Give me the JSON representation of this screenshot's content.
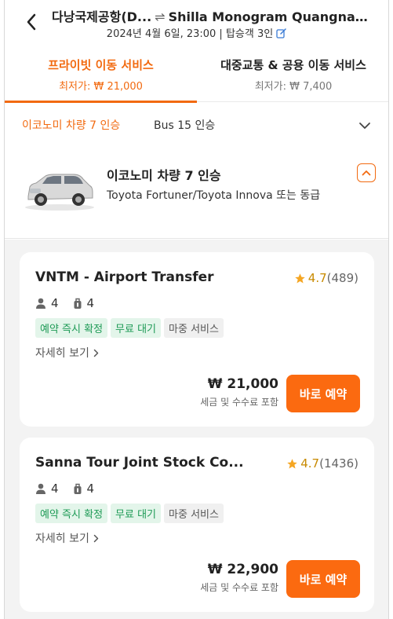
{
  "header": {
    "origin": "다낭국제공항(D...",
    "swap_symbol": "⇌",
    "destination": "Shilla Monogram Quangnam ...",
    "subtitle": "2024년 4월 6일, 23:00 | 탑승객 3인"
  },
  "tabs": [
    {
      "label": "프라이빗 이동 서비스",
      "price": "최저가: ₩ 21,000"
    },
    {
      "label": "대중교통 & 공용 이동 서비스",
      "price": "최저가: ₩ 7,400"
    }
  ],
  "segment": {
    "selected": "이코노미 차량 7 인승",
    "other": "Bus 15 인승"
  },
  "vehicle": {
    "title": "이코노미 차량 7 인승",
    "description": "Toyota Fortuner/Toyota Innova 또는 동급"
  },
  "offers": [
    {
      "name": "VNTM - Airport Transfer",
      "rating": "4.7",
      "reviews": "(489)",
      "passengers": "4",
      "luggage": "4",
      "tags": [
        "예약 즉시 확정",
        "무료 대기",
        "마중 서비스"
      ],
      "details": "자세히 보기",
      "price": "₩ 21,000",
      "fee_note": "세금 및 수수료 포함",
      "book_label": "바로 예약"
    },
    {
      "name": "Sanna Tour Joint Stock Co...",
      "rating": "4.7",
      "reviews": "(1436)",
      "passengers": "4",
      "luggage": "4",
      "tags": [
        "예약 즉시 확정",
        "무료 대기",
        "마중 서비스"
      ],
      "details": "자세히 보기",
      "price": "₩ 22,900",
      "fee_note": "세금 및 수수료 포함",
      "book_label": "바로 예약"
    }
  ],
  "colors": {
    "accent": "#f26a10",
    "button": "#fb6a10",
    "star": "#f5a623",
    "tag_green": "#1d9a55"
  },
  "icons": [
    "back-arrow-icon",
    "edit-icon",
    "chevron-down-icon",
    "chevron-up-icon",
    "star-icon",
    "person-icon",
    "luggage-icon",
    "chevron-right-icon"
  ]
}
